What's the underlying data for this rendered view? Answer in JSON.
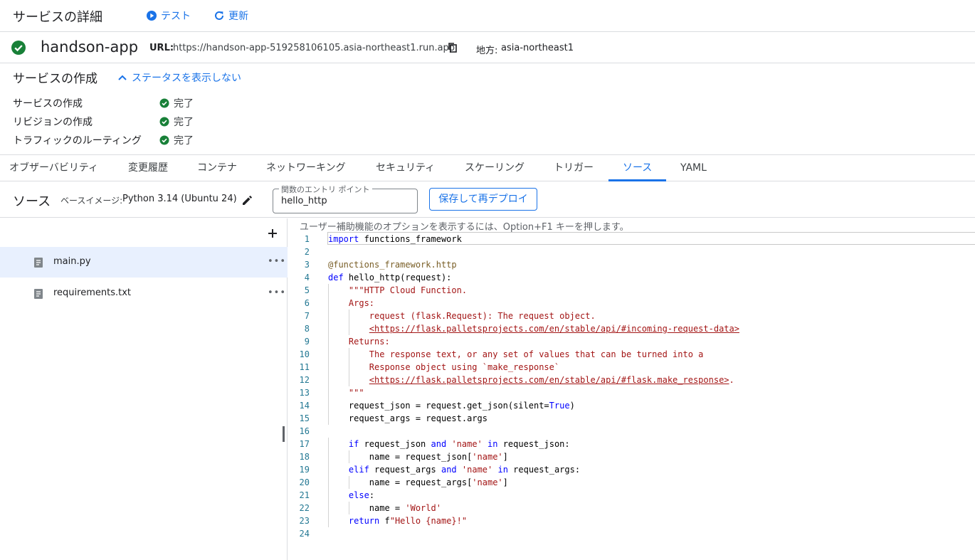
{
  "header": {
    "title": "サービスの詳細",
    "test_label": "テスト",
    "refresh_label": "更新"
  },
  "service": {
    "name": "handson-app",
    "url_label": "URL:",
    "url": "https://handson-app-519258106105.asia-northeast1.run.app",
    "region_label": "地方:",
    "region": "asia-northeast1"
  },
  "creation": {
    "title": "サービスの作成",
    "toggle_label": "ステータスを表示しない",
    "steps": [
      {
        "label": "サービスの作成",
        "status": "完了"
      },
      {
        "label": "リビジョンの作成",
        "status": "完了"
      },
      {
        "label": "トラフィックのルーティング",
        "status": "完了"
      }
    ]
  },
  "tabs": [
    "オブザーバビリティ",
    "変更履歴",
    "コンテナ",
    "ネットワーキング",
    "セキュリティ",
    "スケーリング",
    "トリガー",
    "ソース",
    "YAML"
  ],
  "active_tab": "ソース",
  "source": {
    "title": "ソース",
    "base_image_label": "ベースイメージ:",
    "base_image": "Python 3.14 (Ubuntu 24)",
    "entry_point_label": "関数のエントリ ポイント",
    "entry_point": "hello_http",
    "redeploy_label": "保存して再デプロイ"
  },
  "files": [
    {
      "name": "main.py",
      "selected": true
    },
    {
      "name": "requirements.txt",
      "selected": false
    }
  ],
  "editor": {
    "a11y_hint": "ユーザー補助機能のオプションを表示するには、Option+F1 キーを押します。",
    "lines": [
      "import functions_framework",
      "",
      "@functions_framework.http",
      "def hello_http(request):",
      "    \"\"\"HTTP Cloud Function.",
      "    Args:",
      "        request (flask.Request): The request object.",
      "        <https://flask.palletsprojects.com/en/stable/api/#incoming-request-data>",
      "    Returns:",
      "        The response text, or any set of values that can be turned into a",
      "        Response object using `make_response`",
      "        <https://flask.palletsprojects.com/en/stable/api/#flask.make_response>.",
      "    \"\"\"",
      "    request_json = request.get_json(silent=True)",
      "    request_args = request.args",
      "",
      "    if request_json and 'name' in request_json:",
      "        name = request_json['name']",
      "    elif request_args and 'name' in request_args:",
      "        name = request_args['name']",
      "    else:",
      "        name = 'World'",
      "    return f\"Hello {name}!\"",
      ""
    ]
  },
  "colors": {
    "accent": "#1a73e8",
    "success": "#188038",
    "selected_row": "#e8f0fe",
    "keyword": "#0000ff",
    "string": "#a31515",
    "line_number": "#237893"
  }
}
